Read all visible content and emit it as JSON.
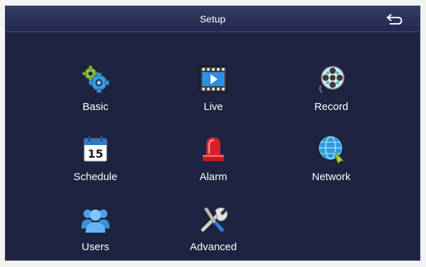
{
  "header": {
    "title": "Setup",
    "back_icon": "back-arrow-icon"
  },
  "menu": [
    {
      "label": "Basic",
      "icon": "gears-icon"
    },
    {
      "label": "Live",
      "icon": "film-play-icon"
    },
    {
      "label": "Record",
      "icon": "film-reel-icon"
    },
    {
      "label": "Schedule",
      "icon": "calendar-icon",
      "icon_text": "15"
    },
    {
      "label": "Alarm",
      "icon": "alarm-siren-icon"
    },
    {
      "label": "Network",
      "icon": "globe-icon"
    },
    {
      "label": "Users",
      "icon": "users-icon"
    },
    {
      "label": "Advanced",
      "icon": "tools-icon"
    }
  ],
  "colors": {
    "background": "#1d2340",
    "titlebar": "#2a315a",
    "text": "#ffffff"
  }
}
